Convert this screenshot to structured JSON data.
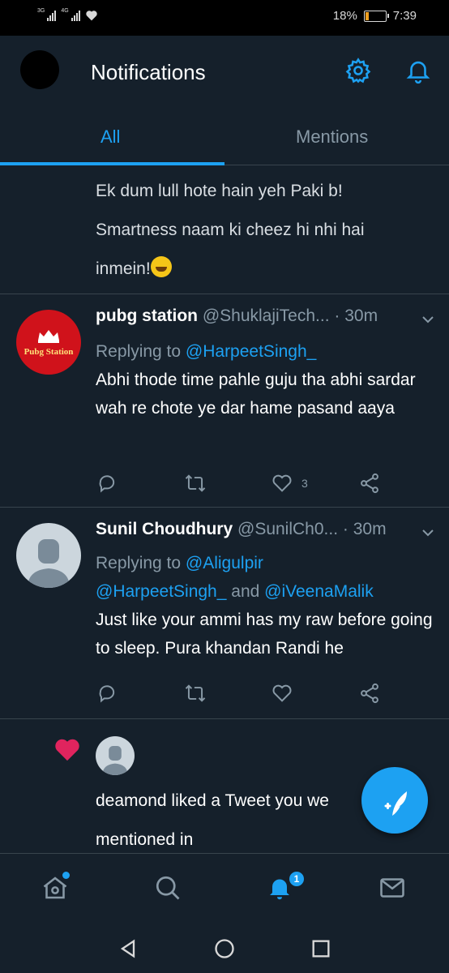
{
  "status_bar": {
    "net1": "3G",
    "net2": "4G",
    "battery_text": "18%",
    "battery_level": 0.18,
    "time": "7:39"
  },
  "header": {
    "title": "Notifications"
  },
  "tabs": [
    {
      "label": "All",
      "active": true
    },
    {
      "label": "Mentions",
      "active": false
    }
  ],
  "continued_tweet": {
    "line1": "Ek dum lull hote hain yeh Paki b!",
    "line2": "Smartness naam ki cheez hi nhi hai",
    "line3": "inmein!"
  },
  "tweets": [
    {
      "avatar_text": "Pubg Station",
      "name": "pubg station",
      "handle": "@ShuklajiTech...",
      "time": "· 30m",
      "replying_label": "Replying to",
      "replying_to": [
        "@HarpeetSingh_"
      ],
      "replying_joiner": "",
      "text": "Abhi thode time pahle guju tha abhi sardar wah re chote ye dar hame pasand aaya",
      "like_count": "3"
    },
    {
      "avatar_text": "",
      "name": "Sunil Choudhury",
      "handle": "@SunilCh0...",
      "time": "· 30m",
      "replying_label": "Replying to",
      "replying_to": [
        "@Aligulpir",
        "@HarpeetSingh_",
        "@iVeenaMalik"
      ],
      "replying_joiner": "and",
      "text": "Just like your ammi has my raw before going to sleep. Pura khandan Randi he",
      "like_count": ""
    }
  ],
  "liked_notification": {
    "line1": "deamond liked a Tweet you we",
    "line2": "mentioned in"
  },
  "bottom_nav": {
    "notifications_badge": "1"
  },
  "colors": {
    "background": "#15202b",
    "accent": "#1da1f2",
    "muted": "#8899a6",
    "divider": "#38444d",
    "like_heart": "#e0245e"
  }
}
